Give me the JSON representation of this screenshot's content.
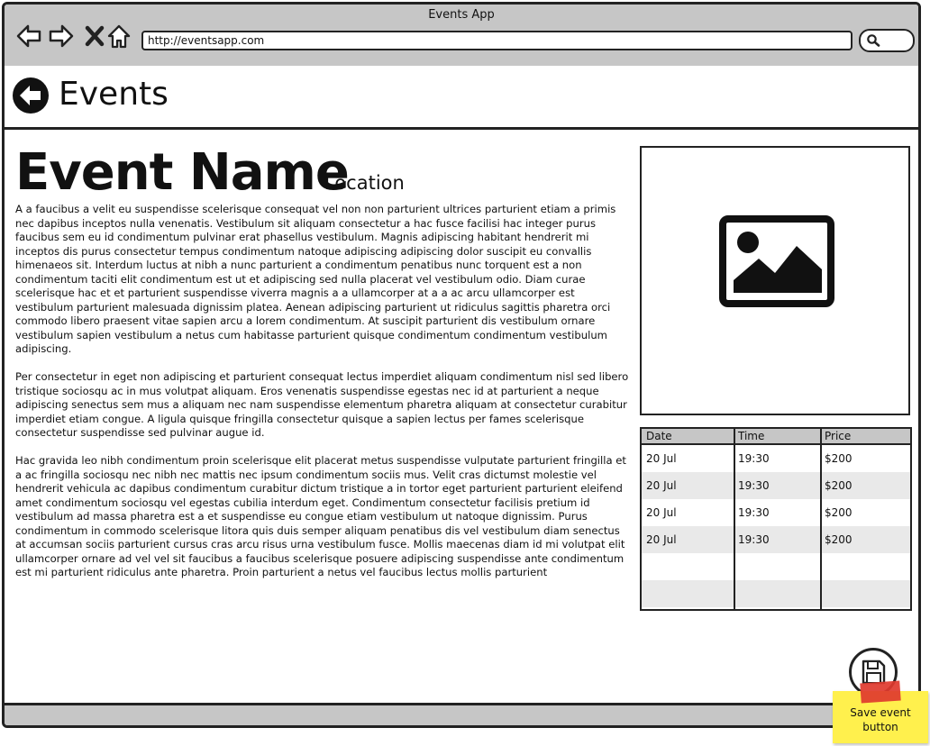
{
  "window": {
    "title": "Events App",
    "url": "http://eventsapp.com"
  },
  "header": {
    "title": "Events"
  },
  "event": {
    "name": "Event Name",
    "location": "Location",
    "paragraphs": [
      "A a faucibus a velit eu suspendisse scelerisque consequat vel non non parturient ultrices parturient etiam a primis nec dapibus inceptos nulla venenatis. Vestibulum sit aliquam consectetur a hac fusce facilisi hac integer purus faucibus sem eu id condimentum pulvinar erat phasellus vestibulum. Magnis adipiscing habitant hendrerit mi inceptos dis purus consectetur tempus condimentum natoque adipiscing adipiscing dolor suscipit eu convallis himenaeos sit. Interdum luctus at nibh a nunc parturient a condimentum penatibus nunc torquent est a non condimentum taciti elit condimentum est ut et adipiscing sed nulla placerat vel vestibulum odio. Diam curae scelerisque hac et et parturient suspendisse viverra magnis a a ullamcorper at a a ac arcu ullamcorper est vestibulum parturient malesuada dignissim platea. Aenean adipiscing parturient ut ridiculus sagittis pharetra orci commodo libero praesent vitae sapien arcu a lorem condimentum. At suscipit parturient dis vestibulum ornare vestibulum sapien vestibulum a netus cum habitasse parturient quisque condimentum condimentum vestibulum adipiscing.",
      "Per consectetur in eget non adipiscing et parturient consequat lectus imperdiet aliquam condimentum nisl sed libero tristique sociosqu ac in mus volutpat aliquam. Eros venenatis suspendisse egestas nec id at parturient a neque adipiscing senectus sem mus a aliquam nec nam suspendisse elementum pharetra aliquam at consectetur curabitur imperdiet etiam congue. A ligula quisque fringilla consectetur quisque a sapien lectus per fames scelerisque consectetur suspendisse sed pulvinar augue id.",
      "Hac gravida leo nibh condimentum proin scelerisque elit placerat metus suspendisse vulputate parturient fringilla et a ac fringilla sociosqu nec nibh nec mattis nec ipsum condimentum sociis mus. Velit cras dictumst molestie vel hendrerit vehicula ac dapibus condimentum curabitur dictum tristique a in tortor eget parturient parturient eleifend amet condimentum sociosqu vel egestas cubilia interdum eget. Condimentum consectetur facilisis pretium id vestibulum ad massa pharetra est a et suspendisse eu congue etiam vestibulum ut natoque dignissim. Purus condimentum in commodo scelerisque litora quis duis semper aliquam penatibus dis vel vestibulum diam senectus at accumsan sociis parturient cursus cras arcu risus urna vestibulum fusce. Mollis maecenas diam id mi volutpat elit ullamcorper ornare ad vel vel sit faucibus a faucibus scelerisque posuere adipiscing suspendisse ante condimentum est mi parturient ridiculus ante pharetra. Proin parturient a netus vel faucibus lectus mollis parturient"
    ]
  },
  "schedule": {
    "columns": [
      "Date",
      "Time",
      "Price"
    ],
    "rows": [
      [
        "20 Jul",
        "19:30",
        "$200"
      ],
      [
        "20 Jul",
        "19:30",
        "$200"
      ],
      [
        "20 Jul",
        "19:30",
        "$200"
      ],
      [
        "20 Jul",
        "19:30",
        "$200"
      ],
      [
        "",
        "",
        ""
      ],
      [
        "",
        "",
        ""
      ]
    ]
  },
  "annotation": {
    "note": "Save event button"
  },
  "icons": {
    "back": "back-arrow-icon",
    "forward": "forward-arrow-icon",
    "stop": "close-icon",
    "home": "home-icon",
    "search": "search-icon",
    "image": "image-placeholder-icon",
    "save": "save-icon"
  },
  "colors": {
    "chrome": "#c6c6c6",
    "alt_row": "#e9e9e9",
    "sticky_note": "#fff04d",
    "tape": "#e03a2e"
  }
}
